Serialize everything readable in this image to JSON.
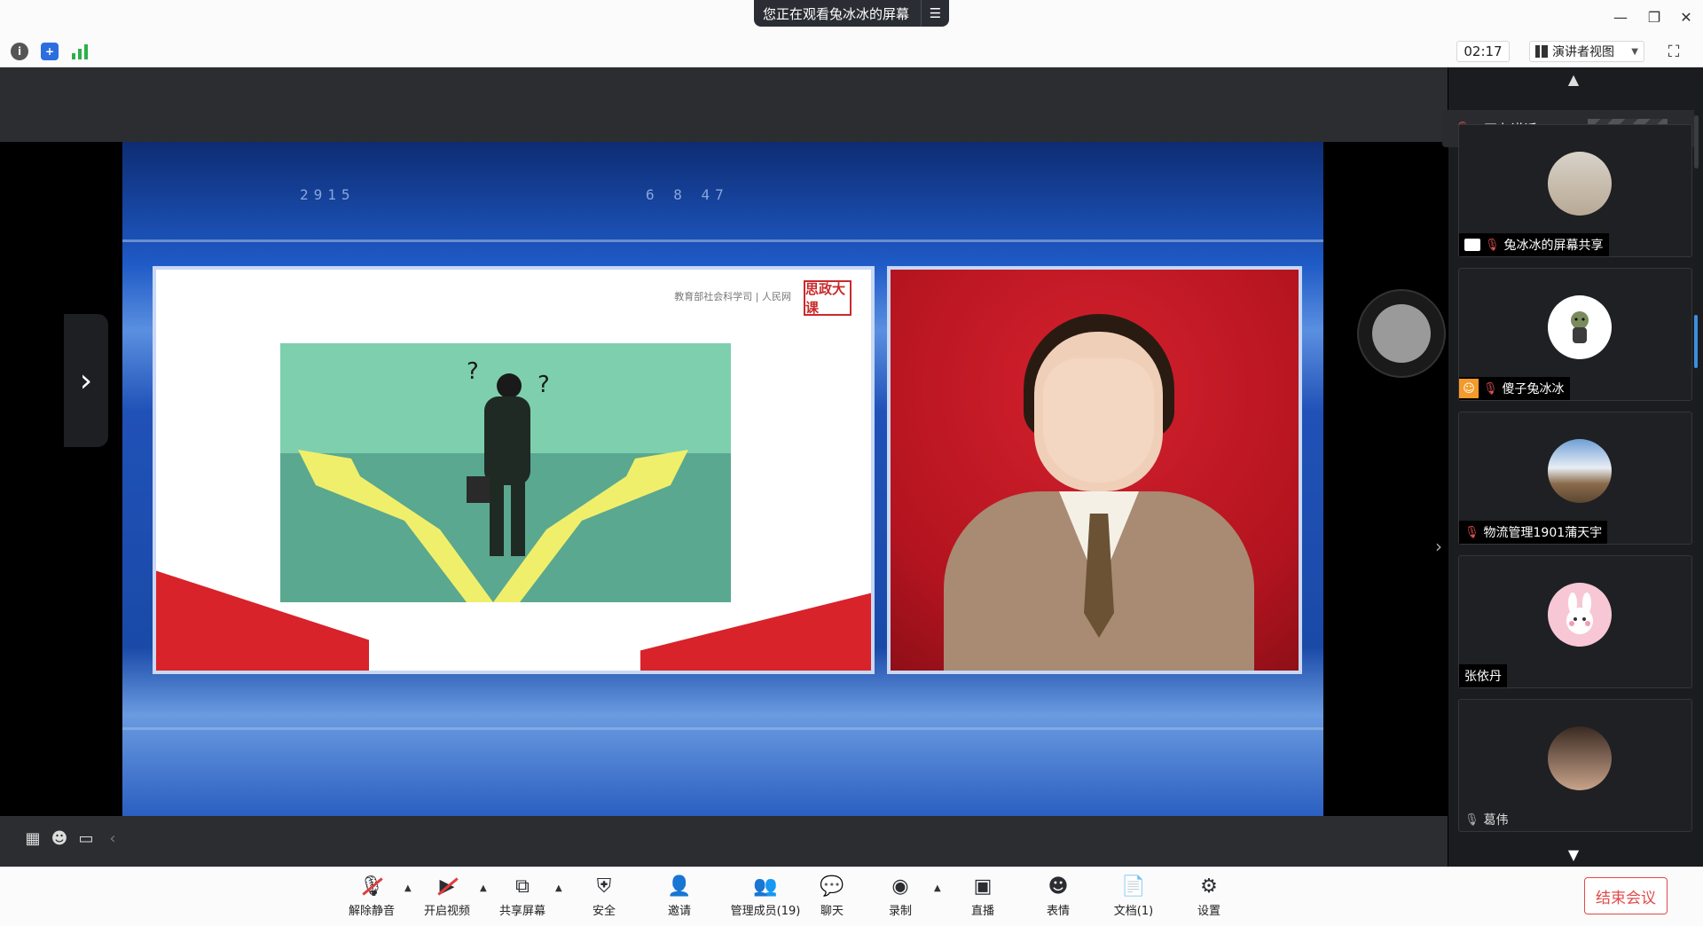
{
  "titlebar": {
    "share_banner": "您正在观看兔冰冰的屏幕",
    "menu_icon": "menu-lines-icon",
    "minimize": "—",
    "restore": "❐",
    "close": "✕"
  },
  "topbar": {
    "icons": [
      "info-icon",
      "shield-icon",
      "signal-icon"
    ],
    "timer": "02:17",
    "view_mode": "演讲者视图",
    "fullscreen_icon": "fullscreen-icon"
  },
  "slide": {
    "header_text": "教育部社会科学司 | 人民网",
    "logo_text": "思政大课"
  },
  "sidebar": {
    "speaking_label": "正在讲话:",
    "participants": [
      {
        "name": "兔冰冰的屏幕共享",
        "avatar": "photo",
        "muted": true,
        "sharing": true,
        "host": false
      },
      {
        "name": "傻子兔冰冰",
        "avatar": "cartoon",
        "muted": true,
        "sharing": false,
        "host": true
      },
      {
        "name": "物流管理1901蒲天宇",
        "avatar": "landscape",
        "muted": true,
        "sharing": false,
        "host": false
      },
      {
        "name": "张依丹",
        "avatar": "bunny",
        "muted": false,
        "sharing": false,
        "host": false
      },
      {
        "name": "葛伟",
        "avatar": "photo",
        "muted": true,
        "sharing": false,
        "host": false
      }
    ]
  },
  "toolbar": {
    "unmute": "解除静音",
    "start_video": "开启视频",
    "share_screen": "共享屏幕",
    "security": "安全",
    "invite": "邀请",
    "manage_members": "管理成员(19)",
    "chat": "聊天",
    "record": "录制",
    "live": "直播",
    "reactions": "表情",
    "docs": "文档(1)",
    "settings": "设置",
    "end_meeting": "结束会议"
  },
  "colors": {
    "accent_red": "#e24a4a",
    "toolbar_bg": "#fbfbfc",
    "stage_bg": "#2b2d31",
    "sidebar_bg": "#1b1c1f"
  }
}
